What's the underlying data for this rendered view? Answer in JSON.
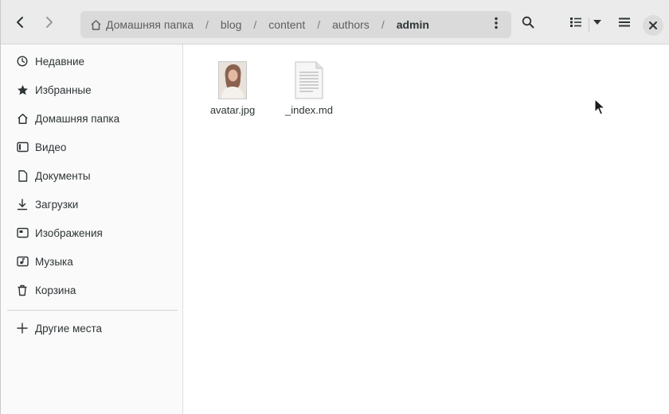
{
  "path": {
    "home_label": "Домашняя папка",
    "segments": [
      "blog",
      "content",
      "authors"
    ],
    "current": "admin",
    "separator": "/"
  },
  "toolbar": {
    "back": "back-icon",
    "forward": "forward-icon",
    "search": "search-icon",
    "view": "list-view-icon",
    "view_options": "chevron-down-icon",
    "menu": "hamburger-menu-icon",
    "close": "close-icon"
  },
  "sidebar": {
    "items": [
      {
        "label": "Недавние",
        "icon": "clock-icon"
      },
      {
        "label": "Избранные",
        "icon": "star-icon"
      },
      {
        "label": "Домашняя папка",
        "icon": "home-icon"
      },
      {
        "label": "Видео",
        "icon": "video-icon"
      },
      {
        "label": "Документы",
        "icon": "document-icon"
      },
      {
        "label": "Загрузки",
        "icon": "download-icon"
      },
      {
        "label": "Изображения",
        "icon": "image-icon"
      },
      {
        "label": "Музыка",
        "icon": "music-icon"
      },
      {
        "label": "Корзина",
        "icon": "trash-icon"
      }
    ],
    "other_places": {
      "label": "Другие места",
      "icon": "plus-icon"
    }
  },
  "files": [
    {
      "name": "avatar.jpg",
      "type": "image"
    },
    {
      "name": "_index.md",
      "type": "text"
    }
  ],
  "colors": {
    "headerbar": "#ebebeb",
    "pathbar": "#dadada",
    "sidebar": "#fafafa",
    "text": "#2e3436"
  }
}
